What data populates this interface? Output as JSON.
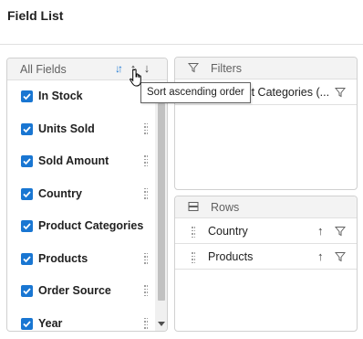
{
  "title": "Field List",
  "all_fields": {
    "header": "All Fields",
    "icons": {
      "sort_toggle": "sort-toggle-icon",
      "sort_asc": "sort-ascending-icon",
      "sort_desc": "sort-descending-icon"
    },
    "items": [
      {
        "label": "In Stock",
        "checked": true
      },
      {
        "label": "Units Sold",
        "checked": true
      },
      {
        "label": "Sold Amount",
        "checked": true
      },
      {
        "label": "Country",
        "checked": true
      },
      {
        "label": "Product Categories",
        "checked": true
      },
      {
        "label": "Products",
        "checked": true
      },
      {
        "label": "Order Source",
        "checked": true
      },
      {
        "label": "Year",
        "checked": true
      }
    ]
  },
  "tooltip": "Sort ascending order",
  "filters": {
    "title": "Filters",
    "items": [
      {
        "label": "Product Categories (..."
      }
    ]
  },
  "rows": {
    "title": "Rows",
    "items": [
      {
        "label": "Country"
      },
      {
        "label": "Products"
      }
    ]
  },
  "colors": {
    "accent": "#1976d2",
    "header_bg": "#f3f3f3",
    "border": "#d0d0d0"
  }
}
